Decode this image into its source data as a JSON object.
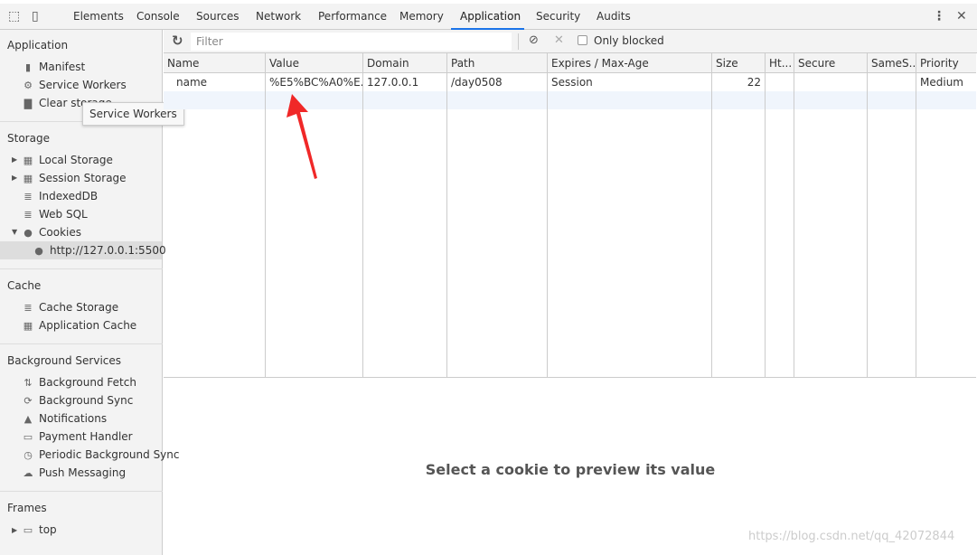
{
  "tabs": [
    "Elements",
    "Console",
    "Sources",
    "Network",
    "Performance",
    "Memory",
    "Application",
    "Security",
    "Audits"
  ],
  "active_tab": "Application",
  "sidebar": {
    "application": {
      "title": "Application",
      "items": [
        {
          "label": "Manifest",
          "icon": "document-icon"
        },
        {
          "label": "Service Workers",
          "icon": "gear-icon"
        },
        {
          "label": "Clear storage",
          "icon": "trash-icon"
        }
      ]
    },
    "storage": {
      "title": "Storage",
      "items": [
        {
          "label": "Local Storage"
        },
        {
          "label": "Session Storage"
        },
        {
          "label": "IndexedDB"
        },
        {
          "label": "Web SQL"
        },
        {
          "label": "Cookies"
        },
        {
          "label": "http://127.0.0.1:5500"
        }
      ]
    },
    "cache": {
      "title": "Cache",
      "items": [
        {
          "label": "Cache Storage"
        },
        {
          "label": "Application Cache"
        }
      ]
    },
    "background": {
      "title": "Background Services",
      "items": [
        {
          "label": "Background Fetch"
        },
        {
          "label": "Background Sync"
        },
        {
          "label": "Notifications"
        },
        {
          "label": "Payment Handler"
        },
        {
          "label": "Periodic Background Sync"
        },
        {
          "label": "Push Messaging"
        }
      ]
    },
    "frames": {
      "title": "Frames",
      "items": [
        {
          "label": "top"
        }
      ]
    }
  },
  "tooltip": "Service Workers",
  "toolbar": {
    "filter_placeholder": "Filter",
    "only_blocked": "Only blocked",
    "only_blocked_checked": false
  },
  "table": {
    "headers": [
      "Name",
      "Value",
      "Domain",
      "Path",
      "Expires / Max-Age",
      "Size",
      "Ht...",
      "Secure",
      "SameS...",
      "Priority"
    ],
    "rows": [
      [
        "name",
        "%E5%BC%A0%E...",
        "127.0.0.1",
        "/day0508",
        "Session",
        "22",
        "",
        "",
        "",
        "Medium"
      ]
    ]
  },
  "preview": "Select a cookie to preview its value",
  "watermark": "https://blog.csdn.net/qq_42072844",
  "colors": {
    "accent": "#1a73e8",
    "arrow": "#f02828",
    "selected_row": "#f0f5fc"
  }
}
